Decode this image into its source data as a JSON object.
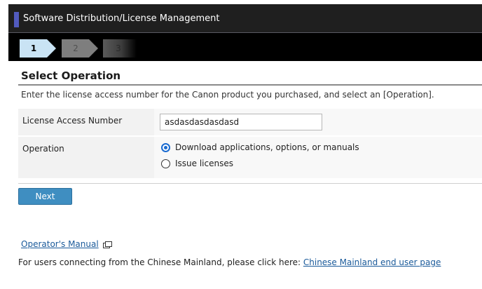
{
  "header": {
    "title": "Software Distribution/License Management"
  },
  "steps": [
    {
      "label": "1",
      "active": true
    },
    {
      "label": "2",
      "active": false
    },
    {
      "label": "3",
      "active": false
    }
  ],
  "section": {
    "title": "Select Operation",
    "instruction": "Enter the license access number for the Canon product you purchased, and select an [Operation]."
  },
  "form": {
    "license_label": "License Access Number",
    "license_value": "asdasdasdasdasd",
    "operation_label": "Operation",
    "operation_options": [
      {
        "label": "Download applications, options, or manuals",
        "selected": true
      },
      {
        "label": "Issue licenses",
        "selected": false
      }
    ]
  },
  "actions": {
    "next_label": "Next"
  },
  "footer": {
    "manual_link": "Operator's Manual",
    "cn_text": "For users connecting from the Chinese Mainland, please click here: ",
    "cn_link": "Chinese Mainland end user page"
  },
  "colors": {
    "accent": "#525bbf",
    "step_active": "#c9e3f4",
    "button": "#3f8ec1",
    "link": "#1a5a9a"
  }
}
